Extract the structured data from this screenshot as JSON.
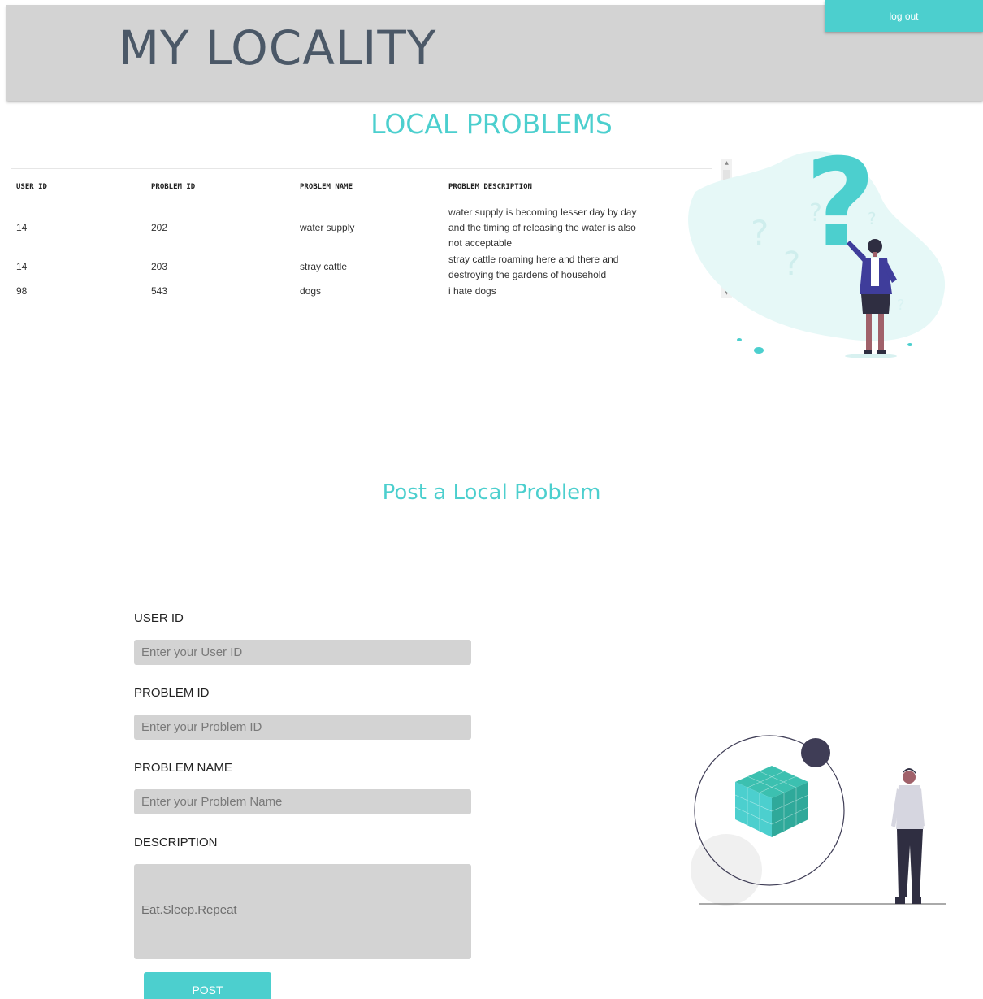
{
  "header": {
    "brand": "MY LOCALITY",
    "logout_label": "log out"
  },
  "problems": {
    "title": "LOCAL PROBLEMS",
    "columns": [
      "USER ID",
      "PROBLEM ID",
      "PROBLEM NAME",
      "PROBLEM DESCRIPTION"
    ],
    "rows": [
      {
        "user_id": "14",
        "problem_id": "202",
        "name": "water supply",
        "description_lines": [
          "water supply is becoming lesser day by day",
          "and the timing of releasing the water is also",
          "not acceptable"
        ]
      },
      {
        "user_id": "14",
        "problem_id": "203",
        "name": "stray cattle",
        "description_lines": [
          "stray cattle roaming here and there and",
          "destroying the gardens of household"
        ]
      },
      {
        "user_id": "98",
        "problem_id": "543",
        "name": "dogs",
        "description_lines": [
          "i hate dogs"
        ]
      }
    ]
  },
  "form": {
    "title": "Post a Local Problem",
    "user_id_label": "USER ID",
    "user_id_placeholder": "Enter your User ID",
    "problem_id_label": "PROBLEM ID",
    "problem_id_placeholder": "Enter your Problem ID",
    "problem_name_label": "PROBLEM NAME",
    "problem_name_placeholder": "Enter your Problem Name",
    "description_label": "DESCRIPTION",
    "description_placeholder": "Eat.Sleep.Repeat",
    "submit_label": "POST"
  },
  "colors": {
    "accent": "#4ccfce",
    "header_bg": "#d3d3d3",
    "brand_text": "#4b5867",
    "input_bg": "#d3d3d3"
  }
}
